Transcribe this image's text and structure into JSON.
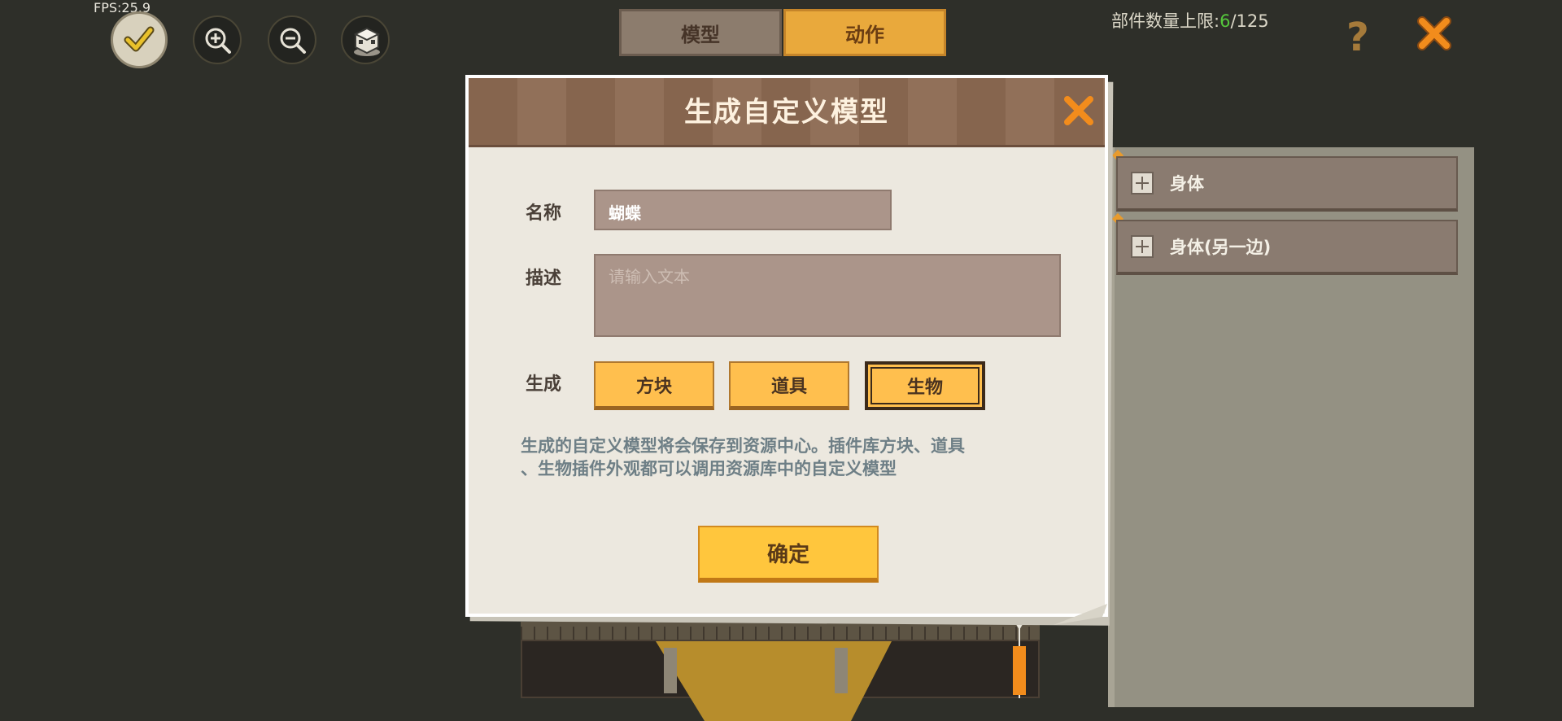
{
  "hud": {
    "fps": "FPS:25.9",
    "part_limit_label": "部件数量上限:",
    "part_count": "6",
    "part_max": "/125"
  },
  "tabs": [
    {
      "label": "模型",
      "active": false
    },
    {
      "label": "动作",
      "active": true
    }
  ],
  "toolbar": {
    "icons": [
      "check-icon",
      "zoom-in-icon",
      "zoom-out-icon",
      "model-cube-icon"
    ]
  },
  "parts": [
    {
      "label": "身体"
    },
    {
      "label": "身体(另一边)"
    }
  ],
  "dialog": {
    "title": "生成自定义模型",
    "name_label": "名称",
    "name_value": "蝴蝶",
    "desc_label": "描述",
    "desc_placeholder": "请输入文本",
    "generate_label": "生成",
    "options": [
      "方块",
      "道具",
      "生物"
    ],
    "selected_option": "生物",
    "info_line1": "生成的自定义模型将会保存到资源中心。插件库方块、道具",
    "info_line2": "、生物插件外观都可以调用资源库中的自定义模型",
    "confirm_label": "确定"
  },
  "colors": {
    "background": "#2e2f29",
    "accent_orange": "#f28c1c",
    "tab_active": "#e9a93c",
    "button_yellow": "#ffbf4e",
    "count_green": "#55c83c"
  }
}
